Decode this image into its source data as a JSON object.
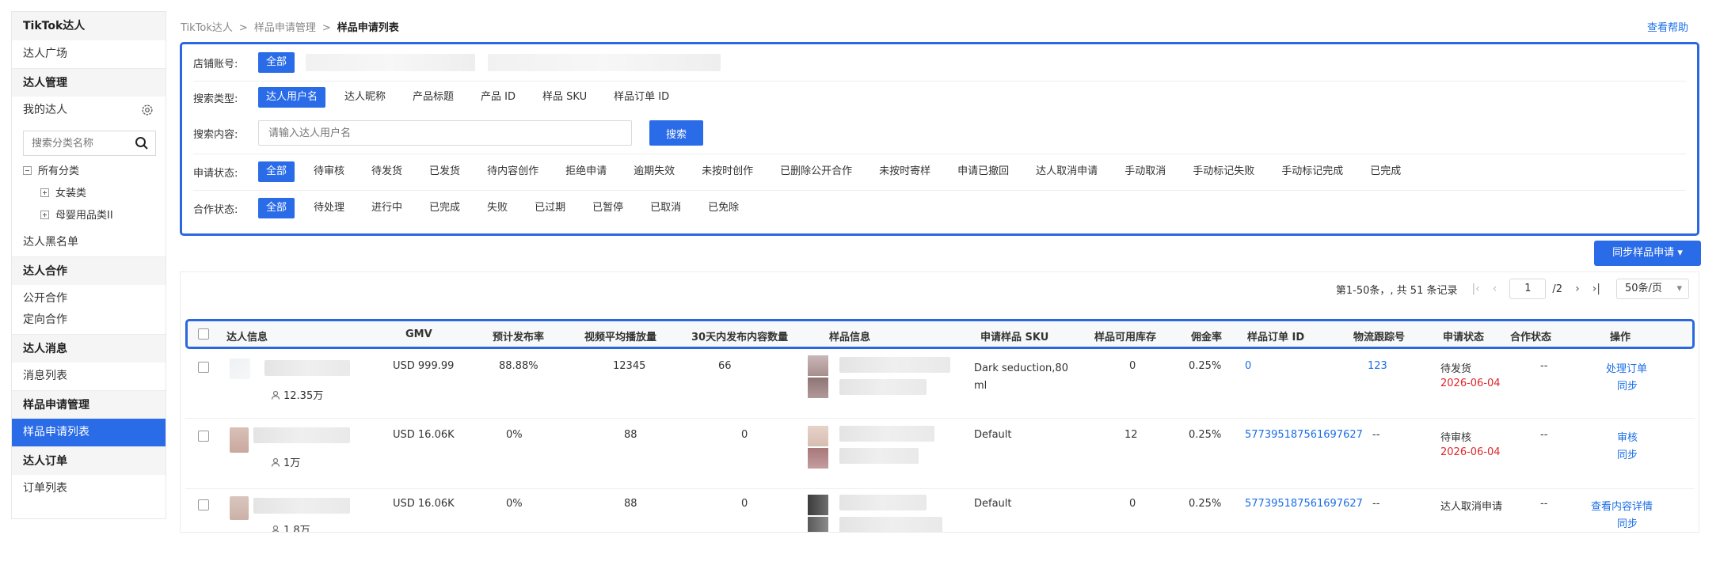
{
  "sidebar": {
    "title": "TikTok达人",
    "items": [
      {
        "type": "item",
        "label": "达人广场"
      },
      {
        "type": "group",
        "label": "达人管理"
      }
    ],
    "my_creators": "我的达人",
    "search_placeholder": "搜索分类名称",
    "tree": [
      "所有分类",
      "女装类",
      "母婴用品类II"
    ],
    "after_tree": [
      {
        "type": "item",
        "label": "达人黑名单"
      },
      {
        "type": "group",
        "label": "达人合作"
      },
      {
        "type": "item",
        "label": "公开合作"
      },
      {
        "type": "item",
        "label": "定向合作"
      },
      {
        "type": "group",
        "label": "达人消息"
      },
      {
        "type": "item",
        "label": "消息列表"
      },
      {
        "type": "group",
        "label": "样品申请管理"
      },
      {
        "type": "item",
        "label": "样品申请列表",
        "active": true
      },
      {
        "type": "group",
        "label": "达人订单"
      },
      {
        "type": "item",
        "label": "订单列表"
      }
    ]
  },
  "breadcrumb": [
    "TikTok达人",
    "样品申请管理",
    "样品申请列表"
  ],
  "help_label": "查看帮助",
  "filters": {
    "shop": {
      "label": "店铺账号:",
      "selected": "全部"
    },
    "search_type": {
      "label": "搜索类型:",
      "options": [
        "达人用户名",
        "达人昵称",
        "产品标题",
        "产品 ID",
        "样品 SKU",
        "样品订单 ID"
      ],
      "selected": 0
    },
    "search_content": {
      "label": "搜索内容:",
      "placeholder": "请输入达人用户名",
      "button": "搜索"
    },
    "apply_status": {
      "label": "申请状态:",
      "options": [
        "全部",
        "待审核",
        "待发货",
        "已发货",
        "待内容创作",
        "拒绝申请",
        "逾期失效",
        "未按时创作",
        "已删除公开合作",
        "未按时寄样",
        "申请已撤回",
        "达人取消申请",
        "手动取消",
        "手动标记失败",
        "手动标记完成",
        "已完成"
      ],
      "selected": 0
    },
    "coop_status": {
      "label": "合作状态:",
      "options": [
        "全部",
        "待处理",
        "进行中",
        "已完成",
        "失败",
        "已过期",
        "已暂停",
        "已取消",
        "已免除"
      ],
      "selected": 0
    }
  },
  "sync_button": "同步样品申请",
  "pagination": {
    "summary": "第1-50条，, 共 51 条记录",
    "current_page": "1",
    "total_pages": "/2",
    "page_size": "50条/页"
  },
  "table": {
    "headers": [
      "达人信息",
      "GMV",
      "预计发布率",
      "视频平均播放量",
      "30天内发布内容数量",
      "样品信息",
      "申请样品 SKU",
      "样品可用库存",
      "佣金率",
      "样品订单 ID",
      "物流跟踪号",
      "申请状态",
      "合作状态",
      "操作"
    ],
    "rows": [
      {
        "followers": "12.35万",
        "gmv": "USD 999.99",
        "publish_rate": "88.88%",
        "avg_views": "12345",
        "posts_30d": "66",
        "sku": "Dark seduction,80 ml",
        "stock": "0",
        "commission": "0.25%",
        "order_id": "0",
        "tracking": "123",
        "status": "待发货",
        "status_date": "2026-06-04",
        "coop": "--",
        "actions": [
          "处理订单",
          "同步"
        ]
      },
      {
        "followers": "1万",
        "gmv": "USD 16.06K",
        "publish_rate": "0%",
        "avg_views": "88",
        "posts_30d": "0",
        "sku": "Default",
        "stock": "12",
        "commission": "0.25%",
        "order_id": "577395187561697627",
        "tracking": "--",
        "status": "待审核",
        "status_date": "2026-06-04",
        "coop": "--",
        "actions": [
          "审核",
          "同步"
        ]
      },
      {
        "followers": "1.8万",
        "gmv": "USD 16.06K",
        "publish_rate": "0%",
        "avg_views": "88",
        "posts_30d": "0",
        "sku": "Default",
        "stock": "0",
        "commission": "0.25%",
        "order_id": "577395187561697627",
        "tracking": "--",
        "status": "达人取消申请",
        "status_date": "",
        "coop": "--",
        "actions": [
          "查看内容详情",
          "同步"
        ]
      }
    ]
  }
}
